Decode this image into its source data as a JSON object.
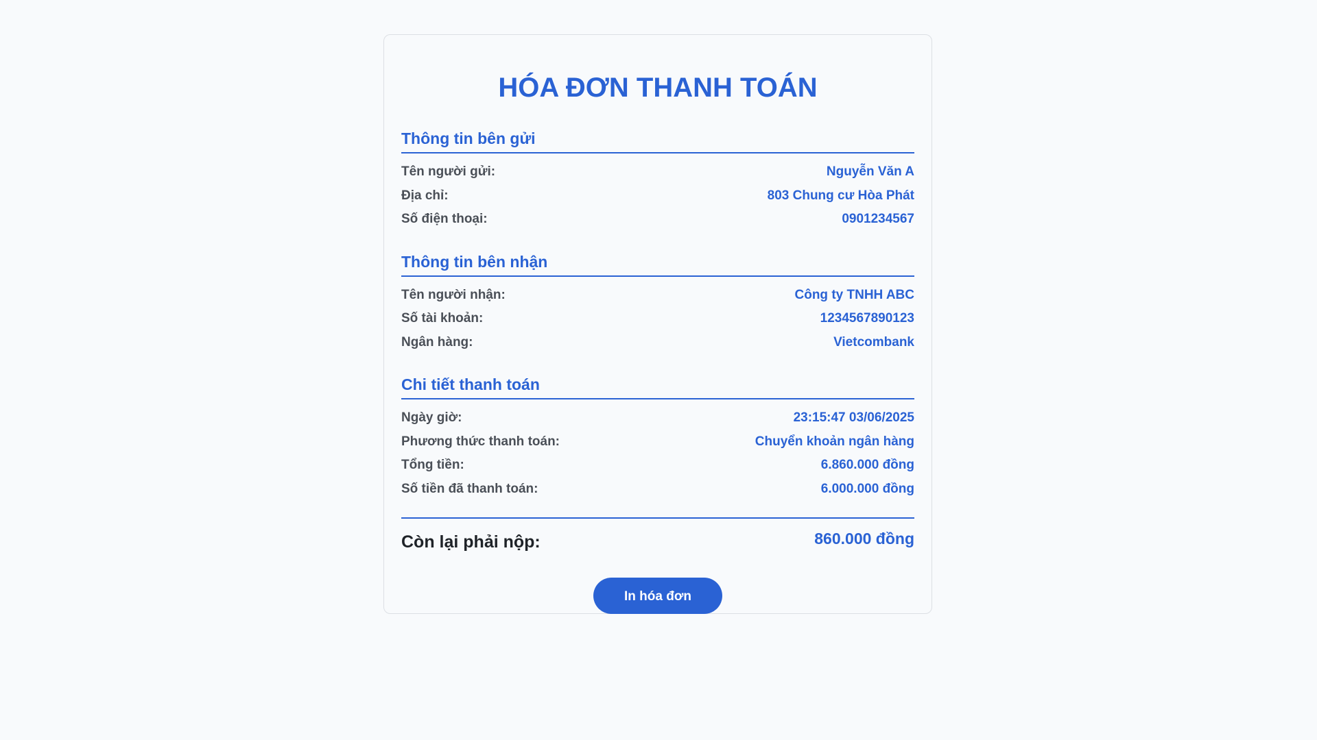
{
  "invoice": {
    "title": "HÓA ĐƠN THANH TOÁN",
    "sender": {
      "heading": "Thông tin bên gửi",
      "rows": [
        {
          "label": "Tên người gửi:",
          "value": "Nguyễn Văn A"
        },
        {
          "label": "Địa chỉ:",
          "value": "803 Chung cư Hòa Phát"
        },
        {
          "label": "Số điện thoại:",
          "value": "0901234567"
        }
      ]
    },
    "receiver": {
      "heading": "Thông tin bên nhận",
      "rows": [
        {
          "label": "Tên người nhận:",
          "value": "Công ty TNHH ABC"
        },
        {
          "label": "Số tài khoản:",
          "value": "1234567890123"
        },
        {
          "label": "Ngân hàng:",
          "value": "Vietcombank"
        }
      ]
    },
    "payment": {
      "heading": "Chi tiết thanh toán",
      "rows": [
        {
          "label": "Ngày giờ:",
          "value": "23:15:47 03/06/2025"
        },
        {
          "label": "Phương thức thanh toán:",
          "value": "Chuyển khoản ngân hàng"
        },
        {
          "label": "Tổng tiền:",
          "value": "6.860.000 đồng"
        },
        {
          "label": "Số tiền đã thanh toán:",
          "value": "6.000.000 đồng"
        }
      ]
    },
    "summary": {
      "label": "Còn lại phải nộp:",
      "value": "860.000 đồng"
    },
    "print_button_label": "In hóa đơn"
  },
  "colors": {
    "accent": "#2a62d4",
    "background": "#f8fafc",
    "label_text": "#4a4f57",
    "border": "#dcdfe4"
  }
}
